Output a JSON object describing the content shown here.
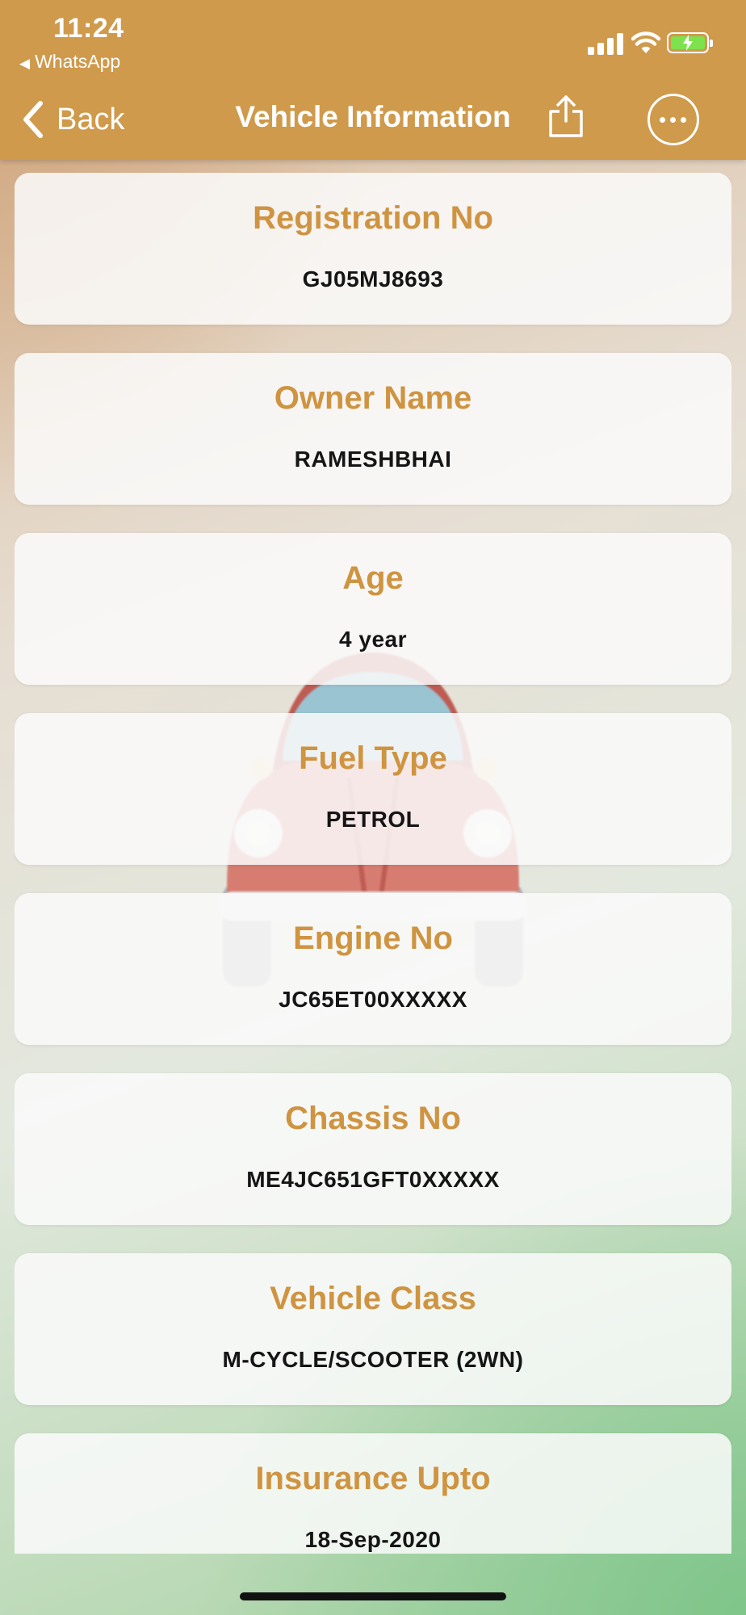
{
  "status_bar": {
    "time": "11:24",
    "back_app": "WhatsApp"
  },
  "nav": {
    "back_label": "Back",
    "title": "Vehicle Information"
  },
  "fields": [
    {
      "label": "Registration No",
      "value": "GJ05MJ8693"
    },
    {
      "label": "Owner Name",
      "value": "RAMESHBHAI"
    },
    {
      "label": "Age",
      "value": "4 year"
    },
    {
      "label": "Fuel Type",
      "value": "PETROL"
    },
    {
      "label": "Engine No",
      "value": "JC65ET00XXXXX"
    },
    {
      "label": "Chassis No",
      "value": "ME4JC651GFT0XXXXX"
    },
    {
      "label": "Vehicle Class",
      "value": "M-CYCLE/SCOOTER (2WN)"
    },
    {
      "label": "Insurance Upto",
      "value": "18-Sep-2020"
    }
  ],
  "colors": {
    "header": "#cf9a4c",
    "label": "#cf9441",
    "value": "#151515"
  },
  "icons": {
    "back": "chevron-left-icon",
    "share": "share-icon",
    "more": "more-icon"
  }
}
